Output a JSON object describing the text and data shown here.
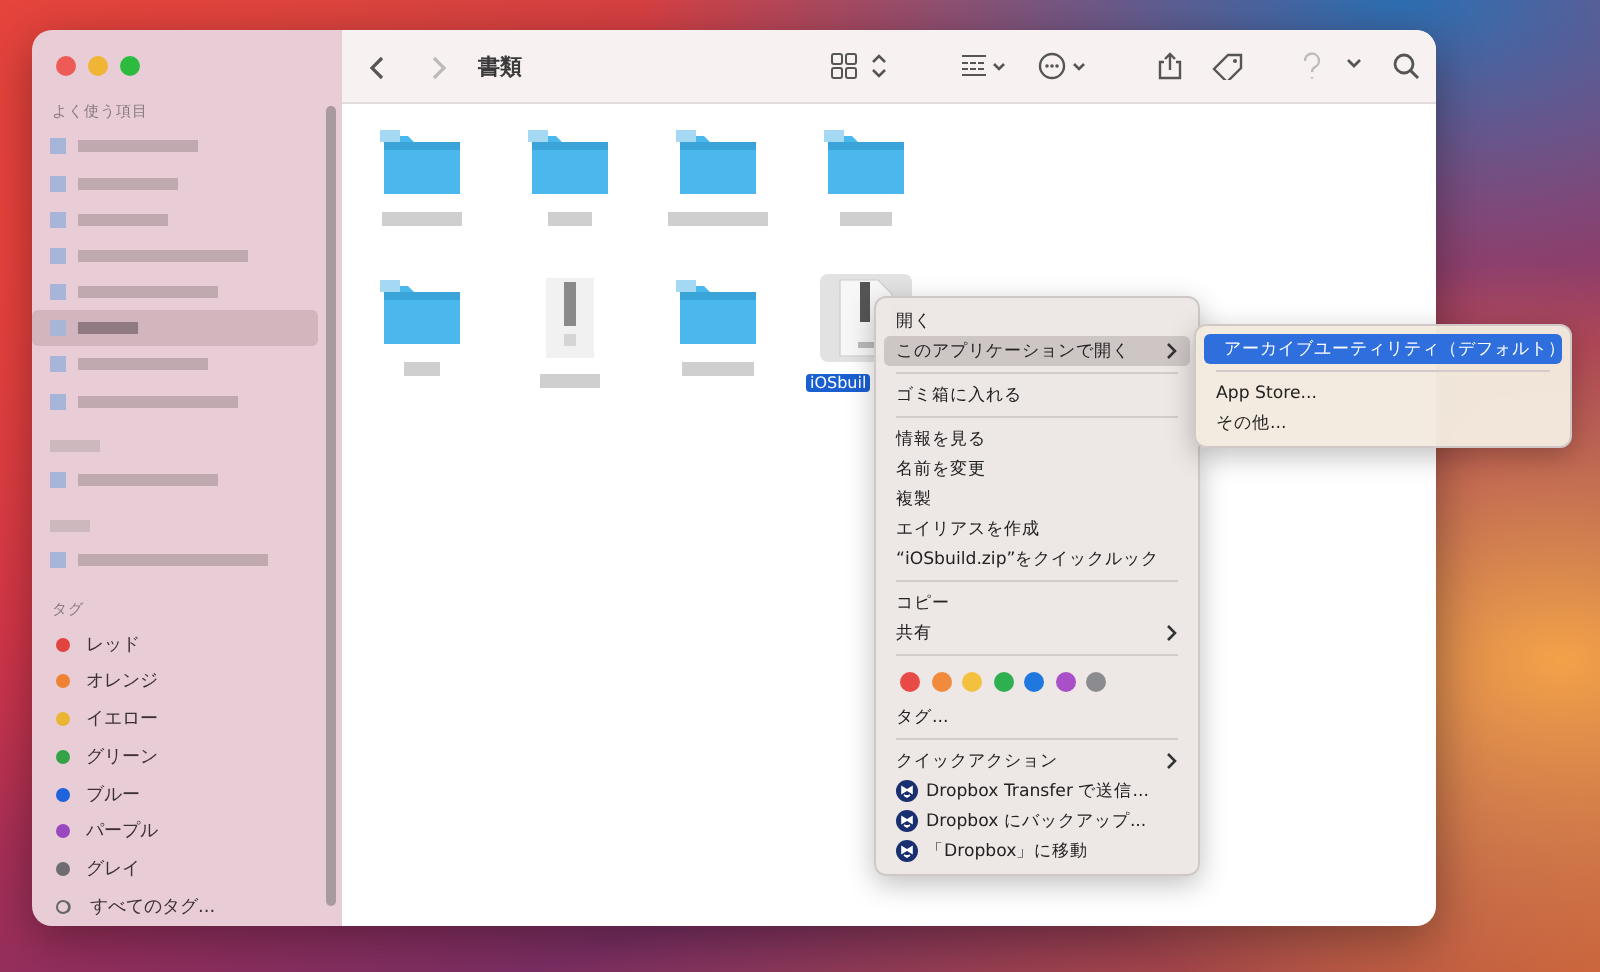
{
  "window": {
    "title": "書類"
  },
  "toolbar": {
    "buttons": [
      {
        "kind": "back",
        "disabled": false
      },
      {
        "kind": "forward",
        "disabled": true
      },
      {
        "kind": "icon-view",
        "disabled": false
      },
      {
        "kind": "updown",
        "disabled": false
      },
      {
        "kind": "group",
        "disabled": false
      },
      {
        "kind": "action",
        "disabled": false
      },
      {
        "kind": "share",
        "disabled": false
      },
      {
        "kind": "tag",
        "disabled": false
      },
      {
        "kind": "help",
        "disabled": true
      },
      {
        "kind": "chevron",
        "disabled": false
      },
      {
        "kind": "search",
        "disabled": false
      }
    ]
  },
  "sidebar": {
    "favorites_header": "よく使う項目",
    "blurred_items": [
      {
        "kind": "item",
        "selected": false
      },
      {
        "kind": "item",
        "selected": false
      },
      {
        "kind": "item",
        "selected": false
      },
      {
        "kind": "item",
        "selected": false
      },
      {
        "kind": "item",
        "selected": false
      },
      {
        "kind": "item",
        "selected": true
      },
      {
        "kind": "item",
        "selected": false
      },
      {
        "kind": "item",
        "selected": false
      },
      {
        "kind": "header",
        "selected": false
      },
      {
        "kind": "item",
        "selected": false
      },
      {
        "kind": "header",
        "selected": false
      },
      {
        "kind": "item",
        "selected": false
      }
    ],
    "tags_header": "タグ",
    "tags": [
      {
        "label": "レッド",
        "color": "#e0443e"
      },
      {
        "label": "オレンジ",
        "color": "#ee8233"
      },
      {
        "label": "イエロー",
        "color": "#eab532"
      },
      {
        "label": "グリーン",
        "color": "#34a347"
      },
      {
        "label": "ブルー",
        "color": "#1e63dc"
      },
      {
        "label": "パープル",
        "color": "#9b47c0"
      },
      {
        "label": "グレイ",
        "color": "#6e6c72"
      }
    ],
    "all_tags": "すべてのタグ..."
  },
  "files": [
    {
      "kind": "folder",
      "selected": false
    },
    {
      "kind": "folder",
      "selected": false
    },
    {
      "kind": "folder",
      "selected": false
    },
    {
      "kind": "folder",
      "selected": false
    },
    {
      "kind": "folder",
      "selected": false
    },
    {
      "kind": "document",
      "selected": false
    },
    {
      "kind": "folder",
      "selected": false
    },
    {
      "kind": "zip",
      "label": "iOSbuil",
      "selected": true
    }
  ],
  "context_menu": {
    "items": [
      {
        "kind": "item",
        "label": "開く",
        "selected": false,
        "has_submenu": false
      },
      {
        "kind": "item",
        "label": "このアプリケーションで開く",
        "selected": true,
        "has_submenu": true
      },
      {
        "kind": "separator"
      },
      {
        "kind": "item",
        "label": "ゴミ箱に入れる",
        "selected": false,
        "has_submenu": false
      },
      {
        "kind": "separator"
      },
      {
        "kind": "item",
        "label": "情報を見る",
        "selected": false,
        "has_submenu": false
      },
      {
        "kind": "item",
        "label": "名前を変更",
        "selected": false,
        "has_submenu": false
      },
      {
        "kind": "item",
        "label": "複製",
        "selected": false,
        "has_submenu": false
      },
      {
        "kind": "item",
        "label": "エイリアスを作成",
        "selected": false,
        "has_submenu": false
      },
      {
        "kind": "item",
        "label": "“iOSbuild.zip”をクイックルック",
        "selected": false,
        "has_submenu": false
      },
      {
        "kind": "separator"
      },
      {
        "kind": "item",
        "label": "コピー",
        "selected": false,
        "has_submenu": false
      },
      {
        "kind": "item",
        "label": "共有",
        "selected": false,
        "has_submenu": true
      },
      {
        "kind": "separator"
      },
      {
        "kind": "colors",
        "colors": [
          {
            "color": "#e84a45"
          },
          {
            "color": "#f08a3c"
          },
          {
            "color": "#f4c040"
          },
          {
            "color": "#2fb050"
          },
          {
            "color": "#1f78e0"
          },
          {
            "color": "#a94fc8"
          },
          {
            "color": "#8c8c90"
          }
        ]
      },
      {
        "kind": "item",
        "label": "タグ...",
        "selected": false,
        "has_submenu": false
      },
      {
        "kind": "separator"
      },
      {
        "kind": "item",
        "label": "クイックアクション",
        "selected": false,
        "has_submenu": true
      },
      {
        "kind": "dropbox",
        "label": "Dropbox Transfer で送信...",
        "selected": false,
        "has_submenu": false
      },
      {
        "kind": "dropbox",
        "label": "Dropbox にバックアップ...",
        "selected": false,
        "has_submenu": false
      },
      {
        "kind": "dropbox",
        "label": "「Dropbox」に移動",
        "selected": false,
        "has_submenu": false
      }
    ]
  },
  "submenu": {
    "items": [
      {
        "kind": "app",
        "label": "アーカイブユーティリティ（デフォルト）",
        "selected": true
      },
      {
        "kind": "separator"
      },
      {
        "kind": "item",
        "label": "App Store...",
        "selected": false
      },
      {
        "kind": "item",
        "label": "その他...",
        "selected": false
      }
    ]
  }
}
